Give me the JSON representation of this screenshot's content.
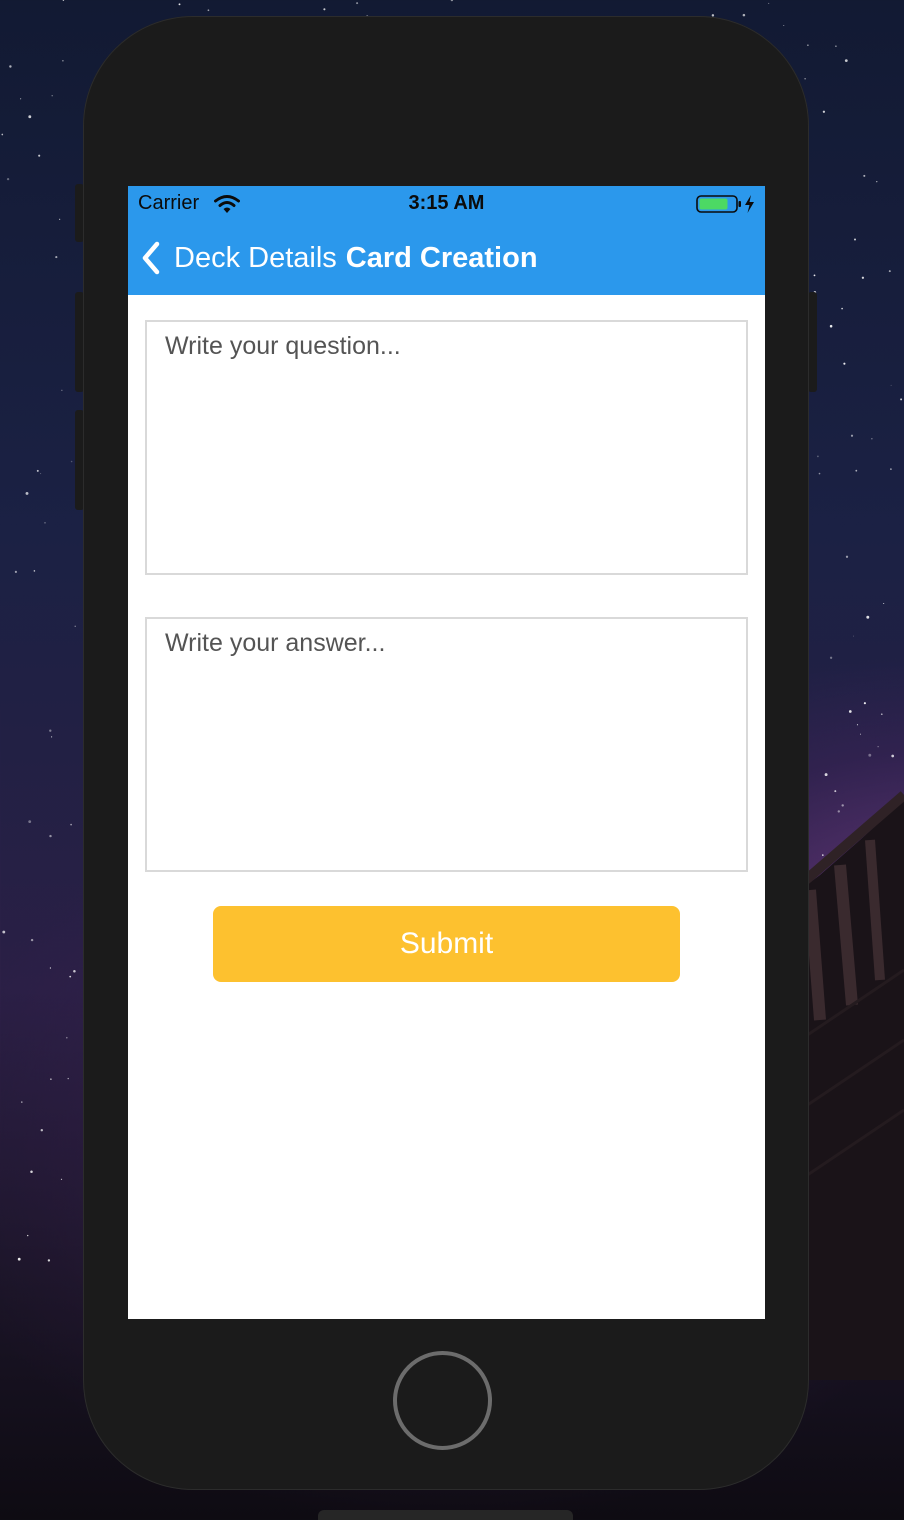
{
  "status_bar": {
    "carrier": "Carrier",
    "time": "3:15 AM",
    "wifi_icon": "wifi-icon",
    "battery_icon": "battery-charging-icon",
    "battery_fill_fraction": 0.8
  },
  "nav": {
    "back_icon": "chevron-left-icon",
    "back_label": "Deck Details",
    "title": "Card Creation"
  },
  "form": {
    "question": {
      "value": "",
      "placeholder": "Write your question..."
    },
    "answer": {
      "value": "",
      "placeholder": "Write your answer..."
    },
    "submit_label": "Submit"
  },
  "colors": {
    "header_background": "#2b98ec",
    "submit_background": "#fdc12f",
    "battery_fill": "#4cd964",
    "phone_body": "#1b1b1b"
  }
}
